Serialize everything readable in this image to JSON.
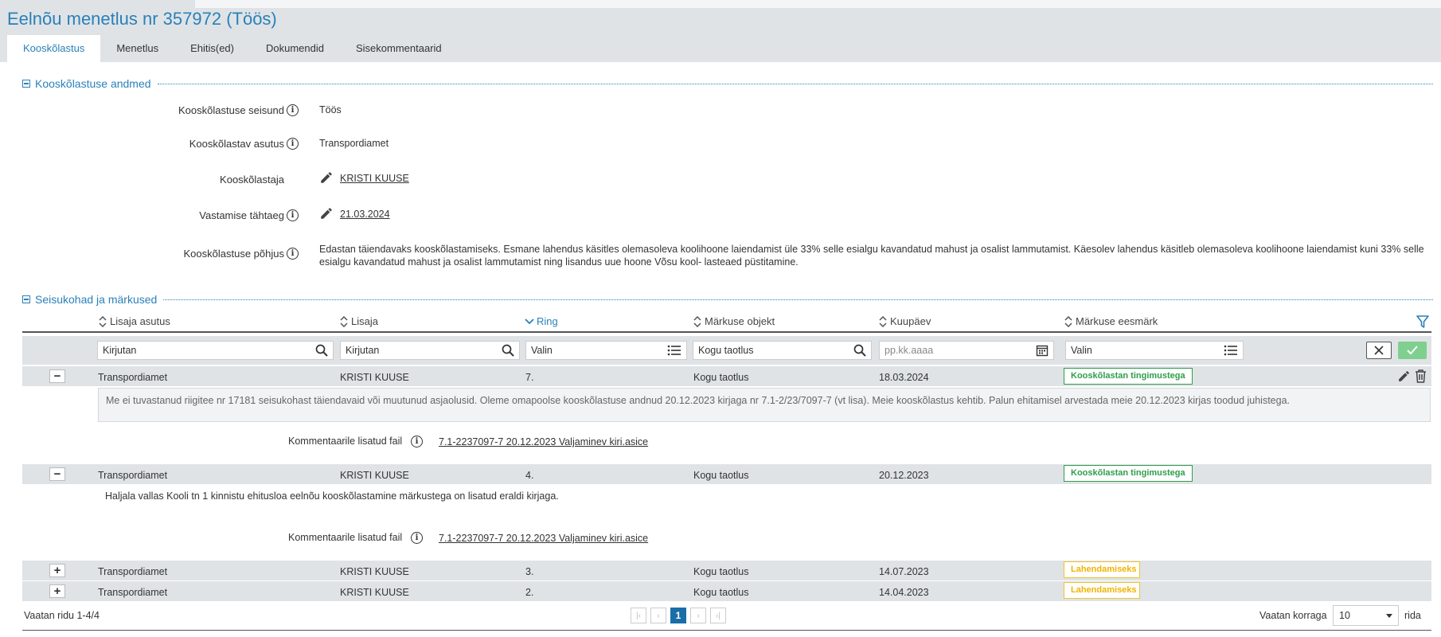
{
  "page": {
    "title": "Eelnõu menetlus nr 357972 (Töös)"
  },
  "tabs": [
    {
      "label": "Kooskõlastus",
      "active": true
    },
    {
      "label": "Menetlus"
    },
    {
      "label": "Ehitis(ed)"
    },
    {
      "label": "Dokumendid"
    },
    {
      "label": "Sisekommentaarid"
    }
  ],
  "info_section": {
    "title": "Kooskõlastuse andmed",
    "rows": [
      {
        "label": "Kooskõlastuse seisund",
        "value": "Töös"
      },
      {
        "label": "Kooskõlastav asutus",
        "value": "Transpordiamet"
      },
      {
        "label": "Kooskõlastaja",
        "value": "KRISTI KUUSE"
      },
      {
        "label": "Vastamise tähtaeg",
        "value": "21.03.2024"
      },
      {
        "label": "Kooskõlastuse põhjus",
        "value": "Edastan täiendavaks kooskõlastamiseks. Esmane lahendus käsitles olemasoleva koolihoone laiendamist üle 33% selle esialgu kavandatud mahust ja osalist lammutamist. Käesolev lahendus käsitleb olemasoleva koolihoone laiendamist kuni 33% selle esialgu kavandatud mahust ja osalist lammutamist ning lisandus uue hoone Võsu kool- lasteaed püstitamine."
      }
    ]
  },
  "remarks_section": {
    "title": "Seisukohad ja märkused",
    "columns": [
      "Lisaja asutus",
      "Lisaja",
      "Ring",
      "Märkuse objekt",
      "Kuupäev",
      "Märkuse eesmärk"
    ],
    "filters": {
      "asutus_placeholder": "Kirjutan",
      "lisaja_placeholder": "Kirjutan",
      "ring_placeholder": "Valin",
      "objekt_value": "Kogu taotlus",
      "kuupaev_placeholder": "pp.kk.aaaa",
      "eesmark_placeholder": "Valin"
    },
    "rows": [
      {
        "asutus": "Transpordiamet",
        "lisaja": "KRISTI KUUSE",
        "ring": "7.",
        "objekt": "Kogu taotlus",
        "kuupaev": "18.03.2024",
        "eesmark": "Kooskõlastan tingimustega",
        "expanded": true,
        "comment": "Me ei tuvastanud riigitee nr 17181 seisukohast täiendavaid või muutunud asjaolusid. Oleme omapoolse kooskõlastuse andnud 20.12.2023 kirjaga nr 7.1-2/23/7097-7 (vt lisa). Meie kooskõlastus kehtib. Palun ehitamisel arvestada meie 20.12.2023 kirjas toodud juhistega.",
        "file_label": "Kommentaarile lisatud fail",
        "file": "7.1-2237097-7 20.12.2023 Valjaminev kiri.asice"
      },
      {
        "asutus": "Transpordiamet",
        "lisaja": "KRISTI KUUSE",
        "ring": "4.",
        "objekt": "Kogu taotlus",
        "kuupaev": "20.12.2023",
        "eesmark": "Kooskõlastan tingimustega",
        "expanded": true,
        "comment": "Haljala vallas Kooli tn 1 kinnistu ehitusloa eelnõu kooskõlastamine märkustega on lisatud eraldi kirjaga.",
        "file_label": "Kommentaarile lisatud fail",
        "file": "7.1-2237097-7 20.12.2023 Valjaminev kiri.asice"
      },
      {
        "asutus": "Transpordiamet",
        "lisaja": "KRISTI KUUSE",
        "ring": "3.",
        "objekt": "Kogu taotlus",
        "kuupaev": "14.07.2023",
        "eesmark": "Lahendamiseks",
        "expanded": false
      },
      {
        "asutus": "Transpordiamet",
        "lisaja": "KRISTI KUUSE",
        "ring": "2.",
        "objekt": "Kogu taotlus",
        "kuupaev": "14.04.2023",
        "eesmark": "Lahendamiseks",
        "expanded": false
      }
    ]
  },
  "footer": {
    "rows_info": "Vaatan ridu 1-4/4",
    "current_page": "1",
    "per_page_label": "Vaatan korraga",
    "per_page_value": "10",
    "per_page_suffix": "rida"
  },
  "colors": {
    "accent": "#2a80b9",
    "band": "#dfe3e6",
    "green": "#2e9e4a",
    "yellow": "#f0b400"
  },
  "icons": [
    "info-icon",
    "pencil-icon",
    "sort-icon",
    "search-icon",
    "list-icon",
    "calendar-icon",
    "filter-icon",
    "close-icon",
    "check-icon",
    "edit-icon",
    "trash-icon",
    "minus-icon",
    "plus-icon"
  ]
}
